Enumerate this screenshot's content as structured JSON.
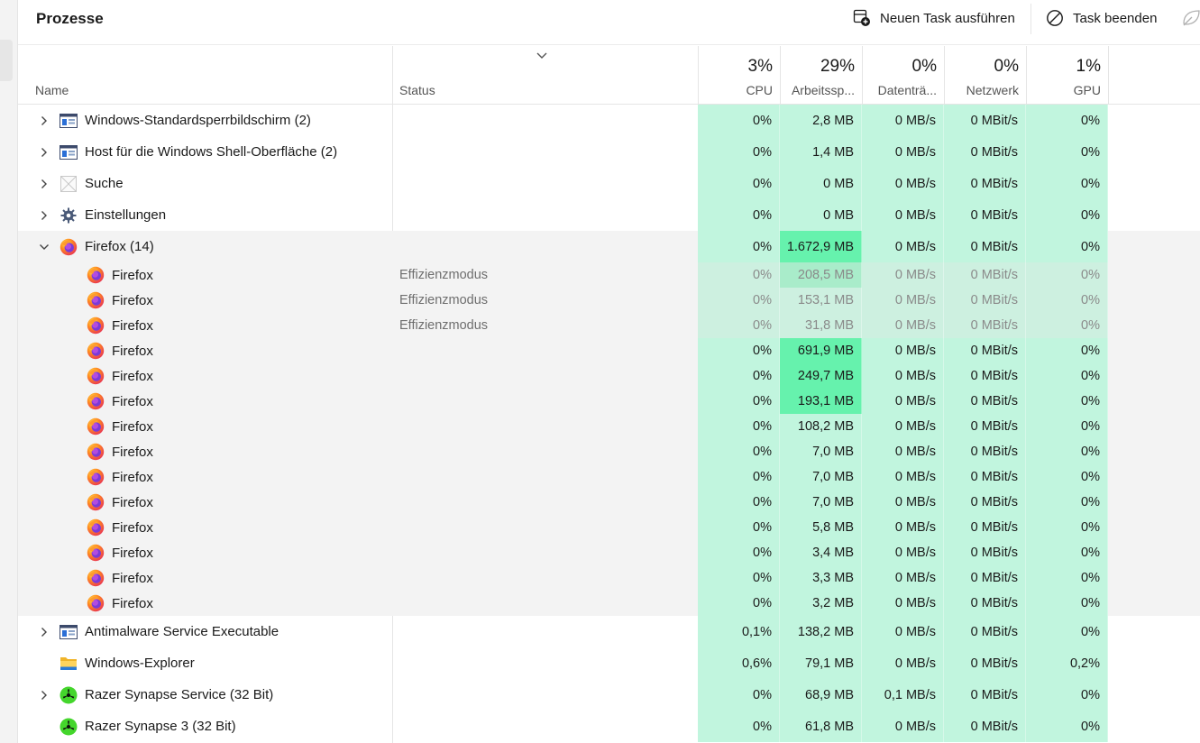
{
  "title": "Prozesse",
  "toolbar": {
    "new_task": "Neuen Task ausführen",
    "end_task": "Task beenden"
  },
  "columns": {
    "name": "Name",
    "status": "Status",
    "cpu": {
      "pct": "3%",
      "label": "CPU"
    },
    "mem": {
      "pct": "29%",
      "label": "Arbeitssp..."
    },
    "disk": {
      "pct": "0%",
      "label": "Datenträ..."
    },
    "net": {
      "pct": "0%",
      "label": "Netzwerk"
    },
    "gpu": {
      "pct": "1%",
      "label": "GPU"
    }
  },
  "colors": {
    "heat_light": "#c1f5de",
    "heat_mid": "#8ef0c2",
    "heat_strong": "#66f2ad",
    "expanded_bg": "#f3f3f3"
  },
  "processes": [
    {
      "name": "Windows-Standardsperrbildschirm (2)",
      "icon": "window-app-icon",
      "chevron": "right",
      "child": false,
      "status": "",
      "cpu": "0%",
      "mem": "2,8 MB",
      "disk": "0 MB/s",
      "net": "0 MBit/s",
      "gpu": "0%",
      "memHeat": "light",
      "faded": false
    },
    {
      "name": "Host für die Windows Shell-Oberfläche (2)",
      "icon": "window-app-icon",
      "chevron": "right",
      "child": false,
      "status": "",
      "cpu": "0%",
      "mem": "1,4 MB",
      "disk": "0 MB/s",
      "net": "0 MBit/s",
      "gpu": "0%",
      "memHeat": "light",
      "faded": false
    },
    {
      "name": "Suche",
      "icon": "search-app-icon",
      "chevron": "right",
      "child": false,
      "status": "",
      "cpu": "0%",
      "mem": "0 MB",
      "disk": "0 MB/s",
      "net": "0 MBit/s",
      "gpu": "0%",
      "memHeat": "light",
      "faded": false
    },
    {
      "name": "Einstellungen",
      "icon": "settings-gear-icon",
      "chevron": "right",
      "child": false,
      "status": "",
      "cpu": "0%",
      "mem": "0 MB",
      "disk": "0 MB/s",
      "net": "0 MBit/s",
      "gpu": "0%",
      "memHeat": "light",
      "faded": false
    },
    {
      "name": "Firefox (14)",
      "icon": "firefox-icon",
      "chevron": "down",
      "child": false,
      "status": "",
      "cpu": "0%",
      "mem": "1.672,9 MB",
      "disk": "0 MB/s",
      "net": "0 MBit/s",
      "gpu": "0%",
      "memHeat": "strong",
      "faded": false
    },
    {
      "name": "Firefox",
      "icon": "firefox-icon",
      "chevron": "",
      "child": true,
      "status": "Effizienzmodus",
      "cpu": "0%",
      "mem": "208,5 MB",
      "disk": "0 MB/s",
      "net": "0 MBit/s",
      "gpu": "0%",
      "memHeat": "mid",
      "faded": true
    },
    {
      "name": "Firefox",
      "icon": "firefox-icon",
      "chevron": "",
      "child": true,
      "status": "Effizienzmodus",
      "cpu": "0%",
      "mem": "153,1 MB",
      "disk": "0 MB/s",
      "net": "0 MBit/s",
      "gpu": "0%",
      "memHeat": "light",
      "faded": true
    },
    {
      "name": "Firefox",
      "icon": "firefox-icon",
      "chevron": "",
      "child": true,
      "status": "Effizienzmodus",
      "cpu": "0%",
      "mem": "31,8 MB",
      "disk": "0 MB/s",
      "net": "0 MBit/s",
      "gpu": "0%",
      "memHeat": "light",
      "faded": true
    },
    {
      "name": "Firefox",
      "icon": "firefox-icon",
      "chevron": "",
      "child": true,
      "status": "",
      "cpu": "0%",
      "mem": "691,9 MB",
      "disk": "0 MB/s",
      "net": "0 MBit/s",
      "gpu": "0%",
      "memHeat": "strong",
      "faded": false
    },
    {
      "name": "Firefox",
      "icon": "firefox-icon",
      "chevron": "",
      "child": true,
      "status": "",
      "cpu": "0%",
      "mem": "249,7 MB",
      "disk": "0 MB/s",
      "net": "0 MBit/s",
      "gpu": "0%",
      "memHeat": "strong",
      "faded": false
    },
    {
      "name": "Firefox",
      "icon": "firefox-icon",
      "chevron": "",
      "child": true,
      "status": "",
      "cpu": "0%",
      "mem": "193,1 MB",
      "disk": "0 MB/s",
      "net": "0 MBit/s",
      "gpu": "0%",
      "memHeat": "strong",
      "faded": false
    },
    {
      "name": "Firefox",
      "icon": "firefox-icon",
      "chevron": "",
      "child": true,
      "status": "",
      "cpu": "0%",
      "mem": "108,2 MB",
      "disk": "0 MB/s",
      "net": "0 MBit/s",
      "gpu": "0%",
      "memHeat": "light",
      "faded": false
    },
    {
      "name": "Firefox",
      "icon": "firefox-icon",
      "chevron": "",
      "child": true,
      "status": "",
      "cpu": "0%",
      "mem": "7,0 MB",
      "disk": "0 MB/s",
      "net": "0 MBit/s",
      "gpu": "0%",
      "memHeat": "light",
      "faded": false
    },
    {
      "name": "Firefox",
      "icon": "firefox-icon",
      "chevron": "",
      "child": true,
      "status": "",
      "cpu": "0%",
      "mem": "7,0 MB",
      "disk": "0 MB/s",
      "net": "0 MBit/s",
      "gpu": "0%",
      "memHeat": "light",
      "faded": false
    },
    {
      "name": "Firefox",
      "icon": "firefox-icon",
      "chevron": "",
      "child": true,
      "status": "",
      "cpu": "0%",
      "mem": "7,0 MB",
      "disk": "0 MB/s",
      "net": "0 MBit/s",
      "gpu": "0%",
      "memHeat": "light",
      "faded": false
    },
    {
      "name": "Firefox",
      "icon": "firefox-icon",
      "chevron": "",
      "child": true,
      "status": "",
      "cpu": "0%",
      "mem": "5,8 MB",
      "disk": "0 MB/s",
      "net": "0 MBit/s",
      "gpu": "0%",
      "memHeat": "light",
      "faded": false
    },
    {
      "name": "Firefox",
      "icon": "firefox-icon",
      "chevron": "",
      "child": true,
      "status": "",
      "cpu": "0%",
      "mem": "3,4 MB",
      "disk": "0 MB/s",
      "net": "0 MBit/s",
      "gpu": "0%",
      "memHeat": "light",
      "faded": false
    },
    {
      "name": "Firefox",
      "icon": "firefox-icon",
      "chevron": "",
      "child": true,
      "status": "",
      "cpu": "0%",
      "mem": "3,3 MB",
      "disk": "0 MB/s",
      "net": "0 MBit/s",
      "gpu": "0%",
      "memHeat": "light",
      "faded": false
    },
    {
      "name": "Firefox",
      "icon": "firefox-icon",
      "chevron": "",
      "child": true,
      "status": "",
      "cpu": "0%",
      "mem": "3,2 MB",
      "disk": "0 MB/s",
      "net": "0 MBit/s",
      "gpu": "0%",
      "memHeat": "light",
      "faded": false
    },
    {
      "name": "Antimalware Service Executable",
      "icon": "window-app-icon",
      "chevron": "right",
      "child": false,
      "status": "",
      "cpu": "0,1%",
      "mem": "138,2 MB",
      "disk": "0 MB/s",
      "net": "0 MBit/s",
      "gpu": "0%",
      "memHeat": "light",
      "faded": false
    },
    {
      "name": "Windows-Explorer",
      "icon": "folder-icon",
      "chevron": "",
      "child": false,
      "status": "",
      "cpu": "0,6%",
      "mem": "79,1 MB",
      "disk": "0 MB/s",
      "net": "0 MBit/s",
      "gpu": "0,2%",
      "memHeat": "light",
      "faded": false
    },
    {
      "name": "Razer Synapse Service (32 Bit)",
      "icon": "razer-icon",
      "chevron": "right",
      "child": false,
      "status": "",
      "cpu": "0%",
      "mem": "68,9 MB",
      "disk": "0,1 MB/s",
      "net": "0 MBit/s",
      "gpu": "0%",
      "memHeat": "light",
      "faded": false
    },
    {
      "name": "Razer Synapse 3 (32 Bit)",
      "icon": "razer-icon",
      "chevron": "",
      "child": false,
      "status": "",
      "cpu": "0%",
      "mem": "61,8 MB",
      "disk": "0 MB/s",
      "net": "0 MBit/s",
      "gpu": "0%",
      "memHeat": "light",
      "faded": false
    }
  ]
}
